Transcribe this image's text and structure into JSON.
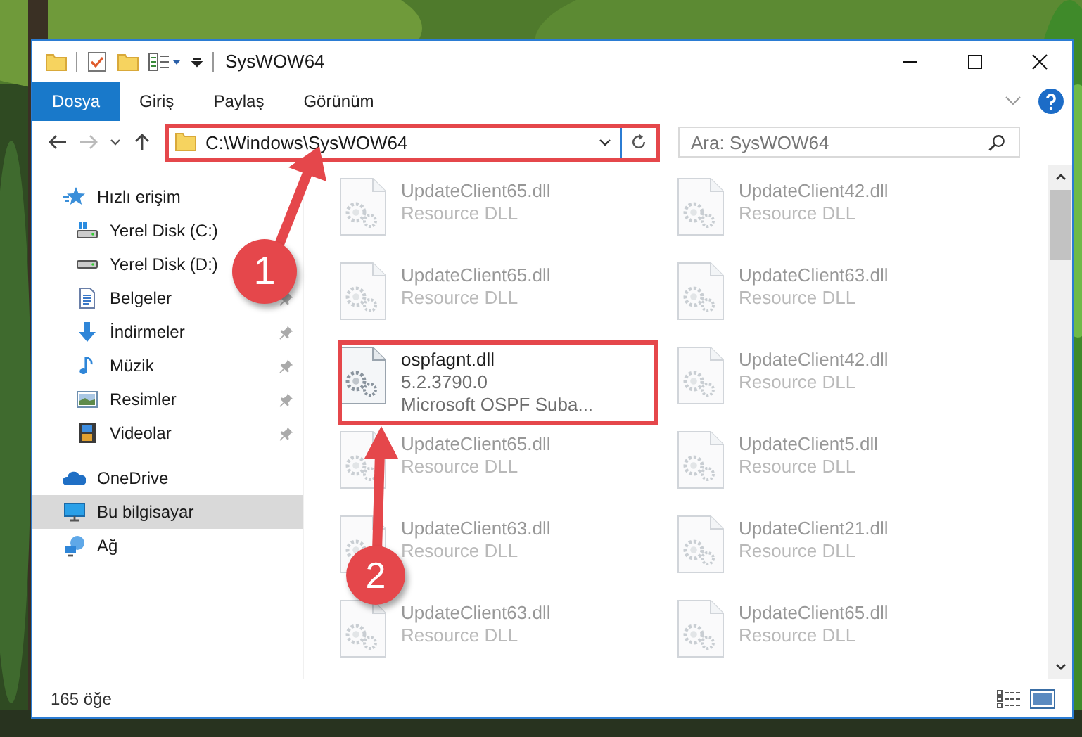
{
  "window": {
    "title": "SysWOW64"
  },
  "ribbon": {
    "tabs": [
      {
        "label": "Dosya",
        "selected": true
      },
      {
        "label": "Giriş",
        "selected": false
      },
      {
        "label": "Paylaş",
        "selected": false
      },
      {
        "label": "Görünüm",
        "selected": false
      }
    ]
  },
  "navigation": {
    "address": "C:\\Windows\\SysWOW64",
    "search": {
      "placeholder": "Ara: SysWOW64"
    }
  },
  "sidebar": {
    "items": [
      {
        "label": "Hızlı erişim",
        "kind": "star",
        "selected": false,
        "children": [
          {
            "label": "Yerel Disk (C:)",
            "kind": "drive-system"
          },
          {
            "label": "Yerel Disk (D:)",
            "kind": "drive"
          },
          {
            "label": "Belgeler",
            "kind": "document",
            "pinned": true
          },
          {
            "label": "İndirmeler",
            "kind": "download",
            "pinned": true
          },
          {
            "label": "Müzik",
            "kind": "music",
            "pinned": true
          },
          {
            "label": "Resimler",
            "kind": "pictures",
            "pinned": true
          },
          {
            "label": "Videolar",
            "kind": "video",
            "pinned": true
          }
        ]
      },
      {
        "label": "OneDrive",
        "kind": "cloud",
        "selected": false
      },
      {
        "label": "Bu bilgisayar",
        "kind": "computer",
        "selected": true
      },
      {
        "label": "Ağ",
        "kind": "network",
        "selected": false
      }
    ]
  },
  "files": [
    {
      "name": "UpdateClient65.dll",
      "lines": [
        "Resource DLL"
      ],
      "dimmed": true
    },
    {
      "name": "UpdateClient42.dll",
      "lines": [
        "Resource DLL"
      ],
      "dimmed": true
    },
    {
      "name": "UpdateClient65.dll",
      "lines": [
        "Resource DLL"
      ],
      "dimmed": true
    },
    {
      "name": "UpdateClient63.dll",
      "lines": [
        "Resource DLL"
      ],
      "dimmed": true
    },
    {
      "name": "ospfagnt.dll",
      "lines": [
        "5.2.3790.0",
        "Microsoft OSPF Suba..."
      ],
      "dimmed": false
    },
    {
      "name": "UpdateClient42.dll",
      "lines": [
        "Resource DLL"
      ],
      "dimmed": true
    },
    {
      "name": "UpdateClient65.dll",
      "lines": [
        "Resource DLL"
      ],
      "dimmed": true
    },
    {
      "name": "UpdateClient5.dll",
      "lines": [
        "Resource DLL"
      ],
      "dimmed": true
    },
    {
      "name": "UpdateClient63.dll",
      "lines": [
        "Resource DLL"
      ],
      "dimmed": true
    },
    {
      "name": "UpdateClient21.dll",
      "lines": [
        "Resource DLL"
      ],
      "dimmed": true
    },
    {
      "name": "UpdateClient63.dll",
      "lines": [
        "Resource DLL"
      ],
      "dimmed": true
    },
    {
      "name": "UpdateClient65.dll",
      "lines": [
        "Resource DLL"
      ],
      "dimmed": true
    }
  ],
  "status_bar": {
    "count": "165 öğe"
  },
  "annotations": [
    {
      "number": "1"
    },
    {
      "number": "2"
    }
  ]
}
